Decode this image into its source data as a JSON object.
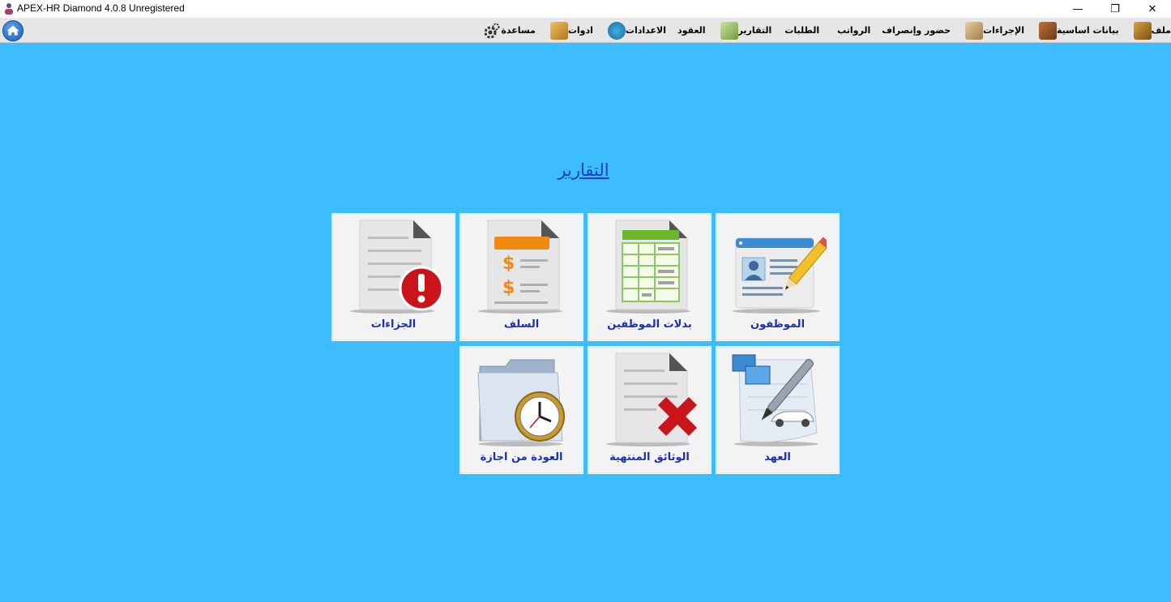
{
  "window": {
    "title": "APEX-HR Diamond 4.0.8 Unregistered",
    "minimize": "—",
    "maximize": "❐",
    "close": "✕"
  },
  "menu": [
    {
      "label": "ملف",
      "icon": "file-menu-icon"
    },
    {
      "label": "بيانات اساسية",
      "icon": "basic-data-icon"
    },
    {
      "label": "الإجراءات",
      "icon": "procedures-icon"
    },
    {
      "label": "حضور وإنصراف",
      "icon": ""
    },
    {
      "label": "الرواتب",
      "icon": ""
    },
    {
      "label": "الطلبات",
      "icon": ""
    },
    {
      "label": "التقارير",
      "icon": "reports-icon"
    },
    {
      "label": "العقود",
      "icon": ""
    },
    {
      "label": "الاعدادات",
      "icon": "settings-icon"
    },
    {
      "label": "ادوات",
      "icon": "tools-icon"
    },
    {
      "label": "مساعدة",
      "icon": "help-gear-icon"
    }
  ],
  "section_title": "التقارير",
  "tiles": {
    "penalties": "الجزاءات",
    "advances": "السلف",
    "allowances": "بدلات الموظفين",
    "employees": "الموظفون",
    "return_from_leave": "العودة من اجازة",
    "expired_documents": "الوثائق المنتهية",
    "custody": "العهد"
  },
  "colors": {
    "background": "#3dbdff",
    "tile": "#f3f3f3",
    "label": "#1a2fb8",
    "title_link": "#1a3fd0"
  }
}
